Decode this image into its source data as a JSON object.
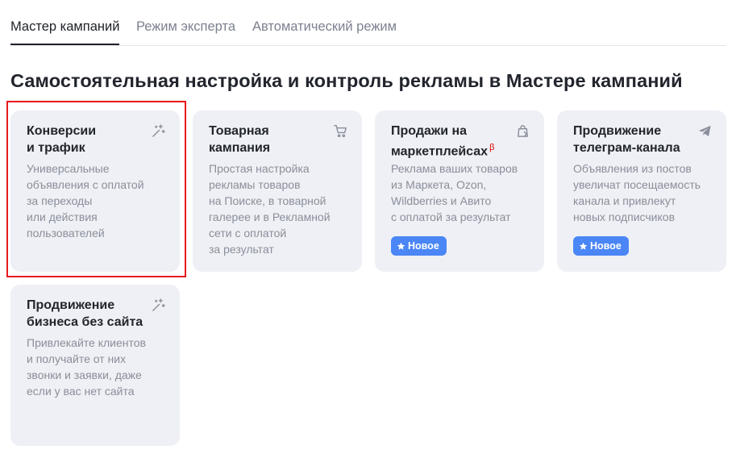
{
  "tabs": [
    {
      "label": "Мастер кампаний",
      "active": true
    },
    {
      "label": "Режим эксперта",
      "active": false
    },
    {
      "label": "Автоматический режим",
      "active": false
    }
  ],
  "page_title": "Самостоятельная настройка и контроль рекламы в Мастере кампаний",
  "cards": [
    {
      "title_line1": "Конверсии",
      "title_line2": "и трафик",
      "description": [
        "Универсальные",
        "объявления с оплатой",
        "за переходы",
        "или действия",
        "пользователей"
      ],
      "icon": "magic-wand-icon",
      "selected": true
    },
    {
      "title_line1": "Товарная",
      "title_line2": "кампания",
      "description": [
        "Простая настройка",
        "рекламы товаров",
        "на Поиске, в товарной",
        "галерее и в Рекламной",
        "сети с оплатой",
        "за результат"
      ],
      "icon": "shopping-cart-icon"
    },
    {
      "title_line1": "Продажи на",
      "title_line2": "маркетплейсах",
      "title_mark": "β",
      "description": [
        "Реклама ваших товаров",
        "из Маркета, Ozon,",
        "Wildberries и Авито",
        "с оплатой за результат"
      ],
      "icon": "shopping-bag-icon",
      "badge": "Новое"
    },
    {
      "title_line1": "Продвижение",
      "title_line2": "телеграм-канала",
      "description": [
        "Объявления из постов",
        "увеличат посещаемость",
        "канала и привлекут",
        "новых подписчиков"
      ],
      "icon": "telegram-plane-icon",
      "badge": "Новое"
    },
    {
      "title_line1": "Продвижение",
      "title_line2": "бизнеса без сайта",
      "description": [
        "Привлекайте клиентов",
        "и получайте от них",
        "звонки и заявки, даже",
        "если у вас нет сайта"
      ],
      "icon": "magic-wand-icon"
    }
  ],
  "colors": {
    "card_bg": "#eef0f5",
    "badge_bg": "#4a86f5",
    "highlight": "#e8191b",
    "beta_mark": "#e00000"
  }
}
